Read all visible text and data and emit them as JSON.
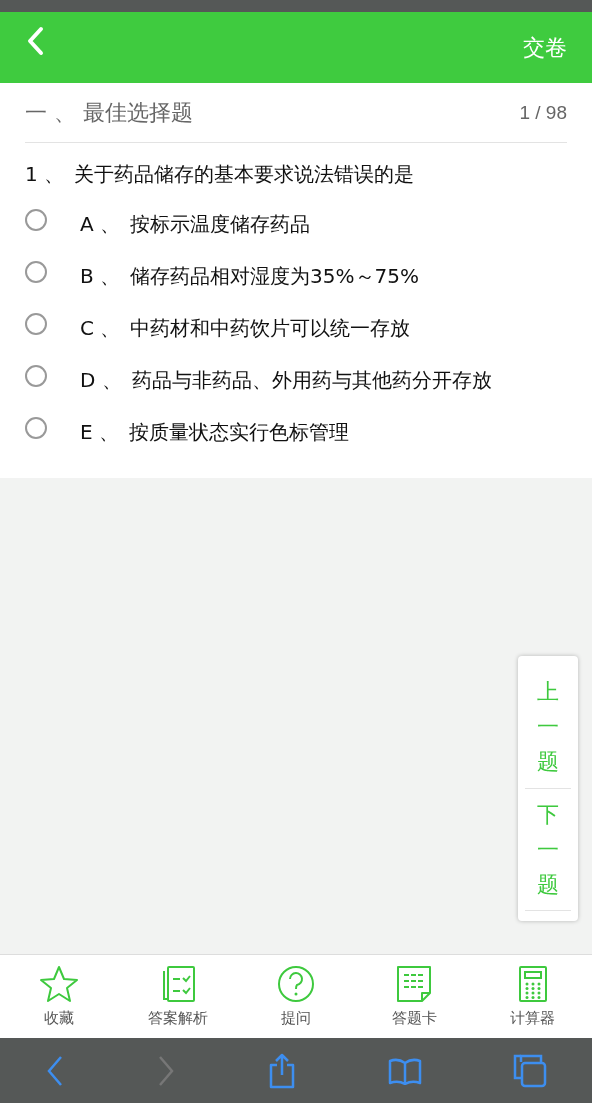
{
  "header": {
    "submit": "交卷"
  },
  "section": {
    "title": "一 、 最佳选择题",
    "progress": "1 / 98"
  },
  "question": {
    "number": "1 、",
    "text": "关于药品储存的基本要求说法错误的是",
    "options": [
      {
        "letter": "A 、",
        "text": "按标示温度储存药品",
        "selected": false
      },
      {
        "letter": "B 、",
        "text": "储存药品相对湿度为35%～75%",
        "selected": false
      },
      {
        "letter": "C 、",
        "text": "中药材和中药饮片可以统一存放",
        "selected": false
      },
      {
        "letter": "D 、",
        "text": "药品与非药品、外用药与其他药分开存放",
        "selected": false
      },
      {
        "letter": "E 、",
        "text": "按质量状态实行色标管理",
        "selected": false
      }
    ]
  },
  "nav_card": {
    "prev": "上一题",
    "next": "下一题"
  },
  "toolbar": [
    {
      "kind": "star",
      "label": "收藏"
    },
    {
      "kind": "analysis",
      "label": "答案解析"
    },
    {
      "kind": "question",
      "label": "提问"
    },
    {
      "kind": "card",
      "label": "答题卡"
    },
    {
      "kind": "calculator",
      "label": "计算器"
    }
  ],
  "browser_bar": {
    "back_disabled": false,
    "forward_disabled": true
  }
}
